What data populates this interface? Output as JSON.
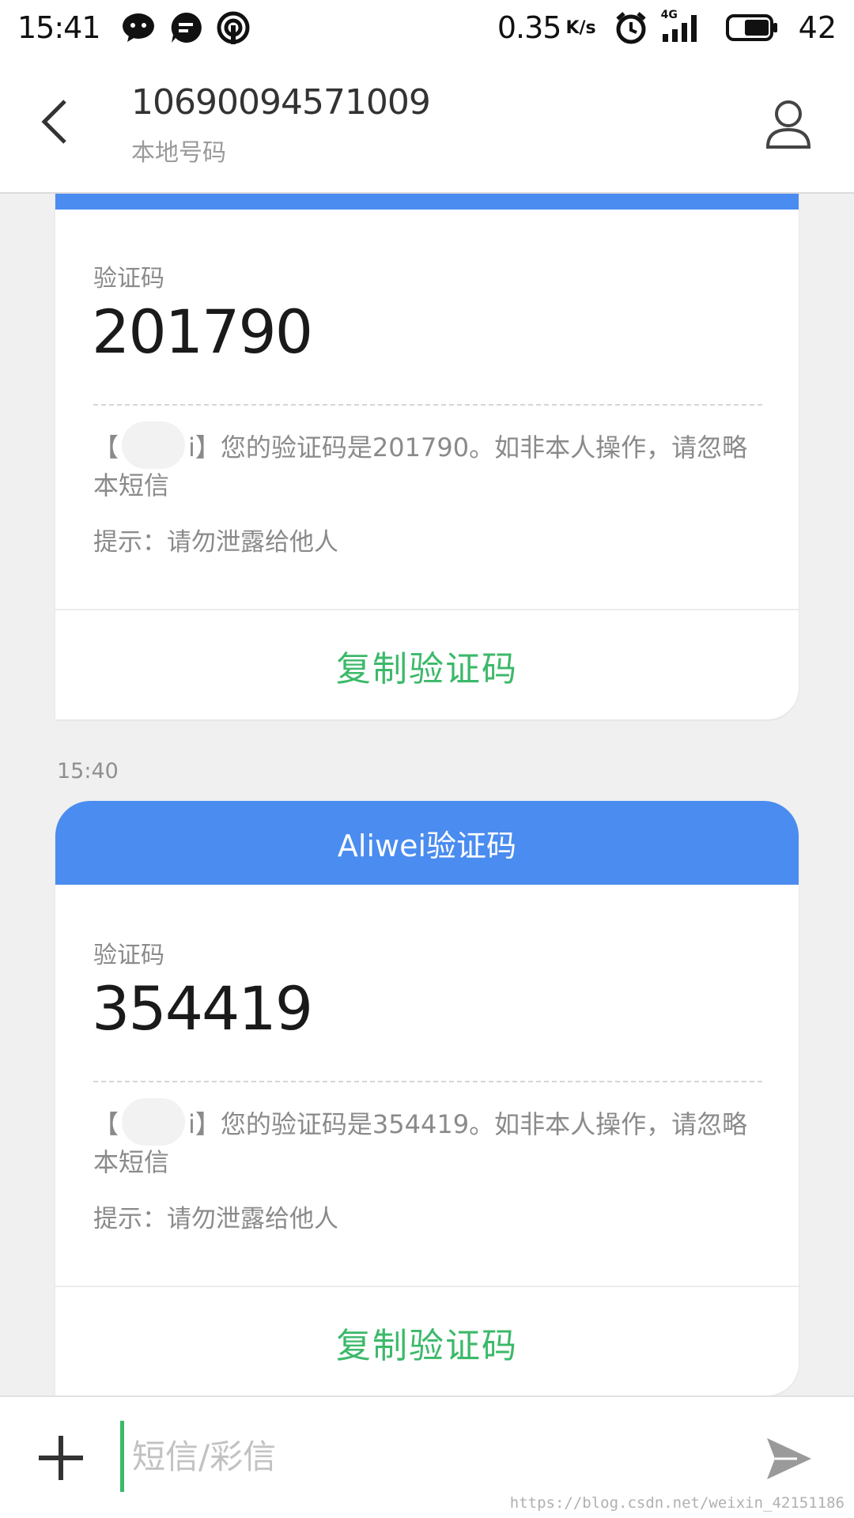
{
  "status_bar": {
    "time": "15:41",
    "speed": "0.35",
    "speed_unit": "K/s",
    "network": "4G",
    "battery": "42",
    "icons": [
      "wechat-icon",
      "chat-bubble-icon",
      "hotspot-icon",
      "alarm-icon",
      "signal-icon",
      "battery-icon"
    ]
  },
  "header": {
    "number": "10690094571009",
    "subtitle": "本地号码",
    "icons": [
      "back-arrow-icon",
      "contact-person-icon"
    ]
  },
  "messages": [
    {
      "title": "",
      "code_label": "验证码",
      "code": "201790",
      "body_prefix": "【",
      "body_sender_suffix": "i",
      "body": "】您的验证码是201790。如非本人操作，请忽略本短信",
      "hint": "提示：请勿泄露给他人",
      "copy_label": "复制验证码"
    },
    {
      "timestamp": "15:40",
      "title": "Aliwei验证码",
      "code_label": "验证码",
      "code": "354419",
      "body_prefix": "【",
      "body_sender_suffix": "i",
      "body": "】您的验证码是354419。如非本人操作，请忽略本短信",
      "hint": "提示：请勿泄露给他人",
      "copy_label": "复制验证码"
    }
  ],
  "input_bar": {
    "placeholder": "短信/彩信",
    "icons": [
      "plus-icon",
      "send-icon"
    ]
  },
  "watermark": "https://blog.csdn.net/weixin_42151186",
  "colors": {
    "accent_blue": "#4a8cf0",
    "copy_green": "#3cb96a",
    "background": "#f0f0f0"
  }
}
